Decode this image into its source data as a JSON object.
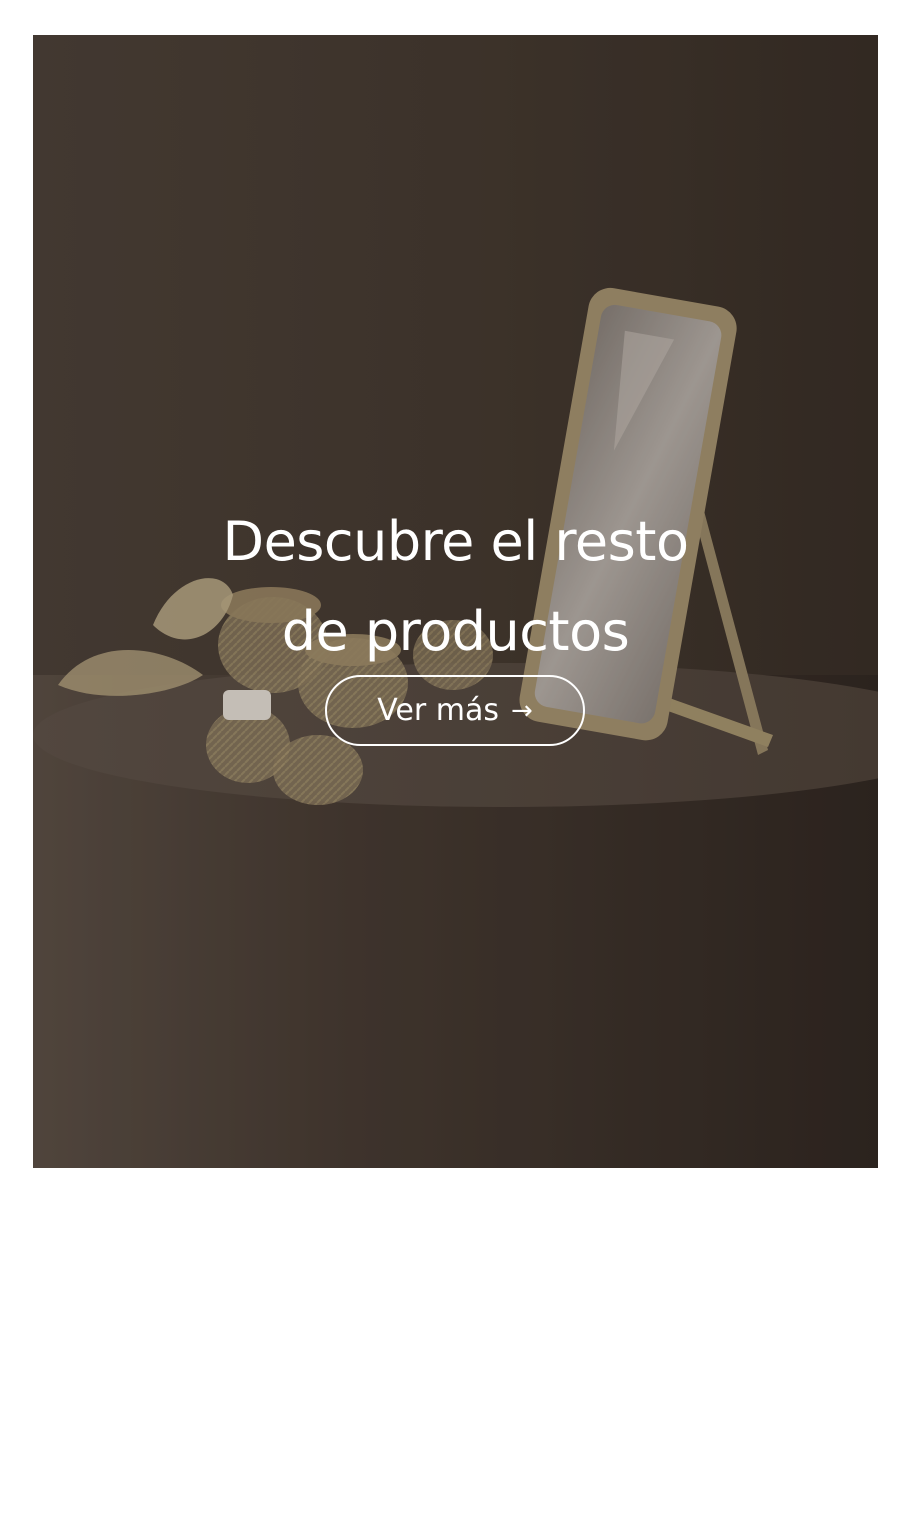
{
  "banner": {
    "headline_line1": "Descubre el resto",
    "headline_line2": "de productos",
    "cta_label": "Ver más",
    "cta_icon": "arrow-right-icon",
    "cta_arrow_glyph": "→"
  },
  "colors": {
    "background_dark": "#3f342d",
    "text": "#ffffff",
    "page_background": "#ffffff"
  }
}
